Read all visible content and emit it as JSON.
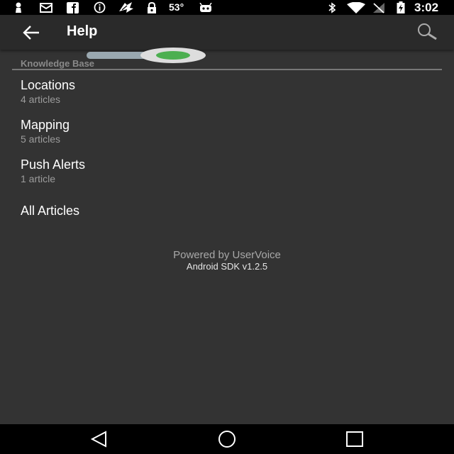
{
  "status_bar": {
    "temperature": "53°",
    "time": "3:02",
    "icons": [
      "person-icon",
      "message-icon",
      "facebook-icon",
      "info-icon",
      "fanatics-icon",
      "lock-icon",
      "android-icon",
      "bluetooth-icon",
      "wifi-icon",
      "no-signal-icon",
      "battery-charging-icon"
    ]
  },
  "app_bar": {
    "title": "Help",
    "back_icon": "arrow-left-icon",
    "search_icon": "search-icon"
  },
  "toggle": {
    "state": "on",
    "accent_color": "#4caf50"
  },
  "section_header": "Knowledge Base",
  "topics": [
    {
      "label": "Locations",
      "count": "4 articles"
    },
    {
      "label": "Mapping",
      "count": "5 articles"
    },
    {
      "label": "Push Alerts",
      "count": "1 article"
    }
  ],
  "all_articles": "All Articles",
  "footer": {
    "powered_by": "Powered by UserVoice",
    "sdk_version": "Android SDK v1.2.5"
  },
  "nav_bar": {
    "back": "triangle-back-icon",
    "home": "circle-home-icon",
    "recents": "square-recents-icon"
  }
}
